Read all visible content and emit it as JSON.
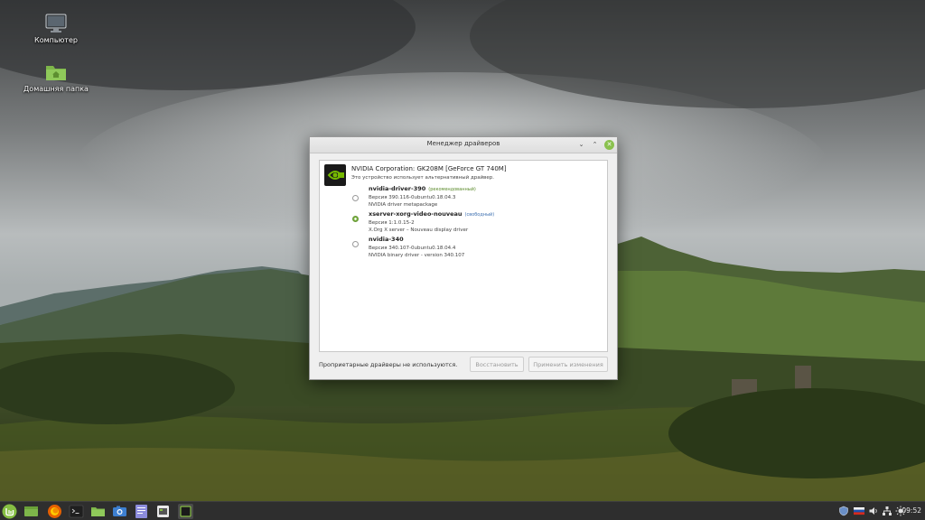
{
  "desktop": {
    "icons": [
      {
        "label": "Компьютер",
        "icon": "computer-icon"
      },
      {
        "label": "Домашняя папка",
        "icon": "home-folder-icon"
      }
    ]
  },
  "window": {
    "title": "Менеджер драйверов",
    "controls": {
      "minimize": "⌄",
      "maximize": "⌃",
      "close": "✕"
    },
    "device": {
      "name": "NVIDIA Corporation: GK208M [GeForce GT 740M]",
      "description": "Это устройство использует альтернативный драйвер."
    },
    "drivers": [
      {
        "name": "nvidia-driver-390",
        "tag": "(рекомендованный)",
        "version": "Версия 390.116-0ubuntu0.18.04.3",
        "description": "NVIDIA driver metapackage",
        "selected": false
      },
      {
        "name": "xserver-xorg-video-nouveau",
        "tag": "(свободный)",
        "version": "Версия 1:1.0.15-2",
        "description": "X.Org X server – Nouveau display driver",
        "selected": true
      },
      {
        "name": "nvidia-340",
        "tag": "",
        "version": "Версия 340.107-0ubuntu0.18.04.4",
        "description": "NVIDIA binary driver - version 340.107",
        "selected": false
      }
    ],
    "status": "Проприетарные драйверы не используются.",
    "buttons": {
      "revert": "Восстановить",
      "apply": "Применить изменения"
    }
  },
  "taskbar": {
    "launchers": [
      "mint-menu-icon",
      "show-desktop-icon",
      "firefox-icon",
      "terminal-icon",
      "files-icon",
      "screenshot-icon",
      "text-editor-icon",
      "software-manager-icon",
      "driver-manager-icon"
    ],
    "tray": [
      "shield-icon",
      "flag-ru-icon",
      "volume-icon",
      "network-icon",
      "brightness-icon"
    ],
    "clock": "09:52"
  },
  "colors": {
    "accent": "#8ac14e",
    "recommended": "#5a8a2a",
    "free": "#3c6fb0",
    "taskbar": "#2e2e2e"
  }
}
